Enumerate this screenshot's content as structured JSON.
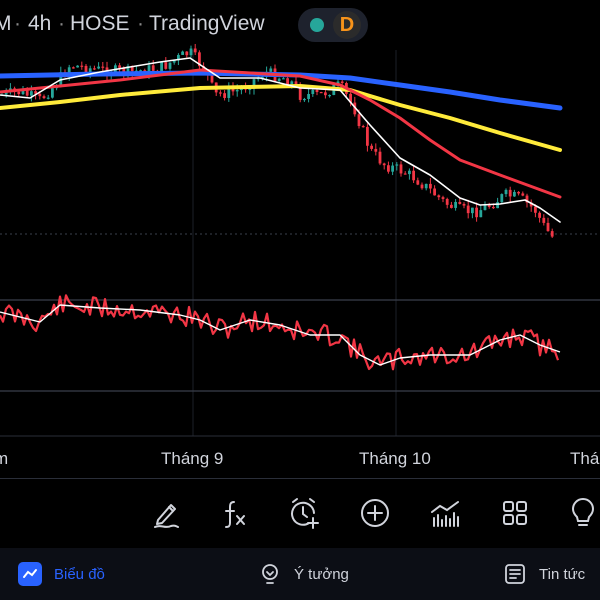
{
  "header": {
    "symbol_fragment": "M",
    "interval": "4h",
    "exchange": "HOSE",
    "source": "TradingView",
    "separator": "·",
    "market_status": "open",
    "badge_letter": "D",
    "colors": {
      "status_dot": "#26a69a",
      "badge_letter": "#f7931a"
    }
  },
  "time_axis": {
    "labels": [
      "m",
      "Tháng 9",
      "Tháng 10",
      "Thá"
    ]
  },
  "chart_data": {
    "type": "candlestick",
    "candles_ohlc": [],
    "moving_averages": [
      {
        "color": "#2962ff"
      },
      {
        "color": "#ffeb3b"
      },
      {
        "color": "#f23645"
      },
      {
        "color": "#ffffff"
      }
    ],
    "oscillator": {
      "lines": [
        {
          "color": "#f23645"
        },
        {
          "color": "#ffffff"
        }
      ]
    },
    "colors": {
      "up": "#26a69a",
      "down": "#f23645"
    }
  },
  "toolbar": {
    "items": [
      {
        "icon": "pencil-draw-icon"
      },
      {
        "icon": "function-fx-icon"
      },
      {
        "icon": "alarm-add-icon"
      },
      {
        "icon": "plus-circle-icon"
      },
      {
        "icon": "indicator-bars-icon"
      },
      {
        "icon": "grid-layout-icon"
      },
      {
        "icon": "lightbulb-icon"
      }
    ]
  },
  "bottom_nav": {
    "items": [
      {
        "label": "Biểu đồ",
        "icon": "chart-icon",
        "active": true
      },
      {
        "label": "Ý tưởng",
        "icon": "idea-bulb-icon",
        "active": false
      },
      {
        "label": "Tin tức",
        "icon": "news-icon",
        "active": false
      }
    ]
  }
}
